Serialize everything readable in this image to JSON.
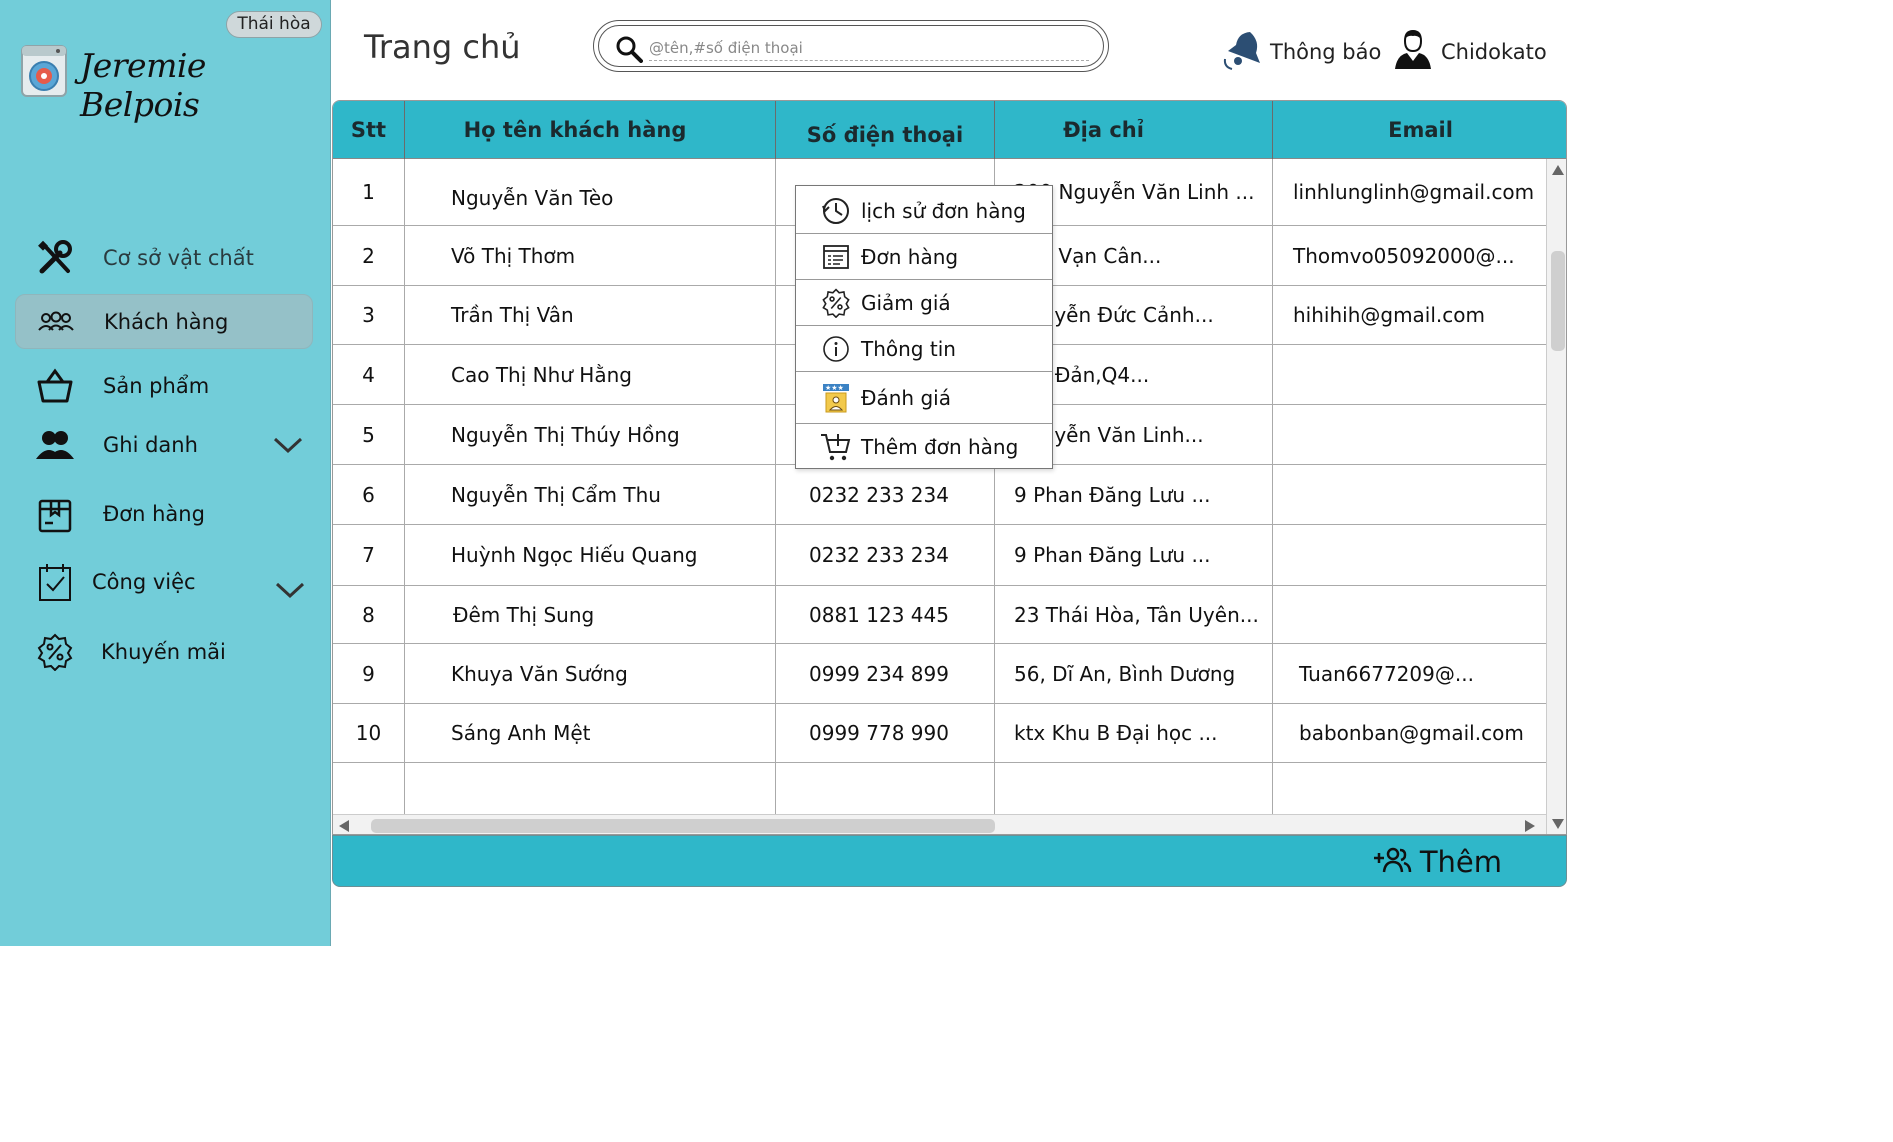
{
  "app": {
    "badge": "Thái hòa",
    "brand": "Jeremie Belpois"
  },
  "sidebar": {
    "items": [
      {
        "label": "Cơ sở vật chất",
        "icon": "tools-icon"
      },
      {
        "label": "Khách hàng",
        "icon": "customers-icon",
        "active": true
      },
      {
        "label": "Sản phẩm",
        "icon": "basket-icon"
      },
      {
        "label": "Ghi danh",
        "icon": "users-icon",
        "expandable": true
      },
      {
        "label": "Đơn hàng",
        "icon": "box-icon"
      },
      {
        "label": "Công việc",
        "icon": "calendar-check-icon",
        "expandable": true
      },
      {
        "label": "Khuyến mãi",
        "icon": "discount-icon"
      }
    ]
  },
  "header": {
    "title": "Trang chủ",
    "search_placeholder": "@tên,#số điện thoại",
    "notifications_label": "Thông báo",
    "user_name": "Chidokato"
  },
  "table": {
    "columns": [
      "Stt",
      "Họ tên khách hàng",
      "Số điện thoại",
      "Địa chỉ",
      "Email"
    ],
    "rows": [
      {
        "stt": "1",
        "name": "Nguyễn Văn Tèo",
        "phone": "",
        "address": "200 Nguyễn Văn Linh ...",
        "email": "linhlunglinh@gmail.com"
      },
      {
        "stt": "2",
        "name": "Võ Thị Thơm",
        "phone": "",
        "address": "Kha Vạn Cân...",
        "email": "Thomvo05092000@..."
      },
      {
        "stt": "3",
        "name": "Trần Thị Vân",
        "phone": "",
        "address": "Nguyễn Đức Cảnh...",
        "email": "hihihih@gmail.com"
      },
      {
        "stt": "4",
        "name": "Cao Thị Như Hằng",
        "phone": "",
        "address": "Tôn Đản,Q4...",
        "email": ""
      },
      {
        "stt": "5",
        "name": "Nguyễn Thị Thúy Hồng",
        "phone": "",
        "address": "Nguyễn Văn Linh...",
        "email": ""
      },
      {
        "stt": "6",
        "name": "Nguyễn Thị Cẩm Thu",
        "phone": "0232 233 234",
        "address": "9 Phan Đăng Lưu ...",
        "email": ""
      },
      {
        "stt": "7",
        "name": "Huỳnh Ngọc Hiếu Quang",
        "phone": "0232 233 234",
        "address": "9 Phan Đăng Lưu ...",
        "email": ""
      },
      {
        "stt": "8",
        "name": "Đêm Thị Sung",
        "phone": "0881 123 445",
        "address": "23 Thái Hòa, Tân Uyên...",
        "email": ""
      },
      {
        "stt": "9",
        "name": "Khuya Văn Sướng",
        "phone": "0999 234 899",
        "address": "56, Dĩ An, Bình Dương",
        "email": "Tuan6677209@..."
      },
      {
        "stt": "10",
        "name": "Sáng Anh Mệt",
        "phone": "0999 778 990",
        "address": "ktx Khu B Đại học ...",
        "email": "babonban@gmail.com"
      },
      {
        "stt": "",
        "name": "",
        "phone": "",
        "address": "",
        "email": ""
      }
    ]
  },
  "context_menu": {
    "items": [
      {
        "label": "lịch sử đơn hàng",
        "icon": "history-icon"
      },
      {
        "label": "Đơn hàng",
        "icon": "order-list-icon"
      },
      {
        "label": "Giảm giá",
        "icon": "discount-icon"
      },
      {
        "label": "Thông tin",
        "icon": "info-icon"
      },
      {
        "label": "Đánh giá",
        "icon": "rating-icon"
      },
      {
        "label": "Thêm đơn hàng",
        "icon": "add-cart-icon"
      }
    ]
  },
  "footer": {
    "add_label": "Thêm"
  },
  "colors": {
    "sidebar_bg": "#72cdd9",
    "header_bg": "#2fb7c9",
    "active_item_bg": "#95c1c8"
  }
}
